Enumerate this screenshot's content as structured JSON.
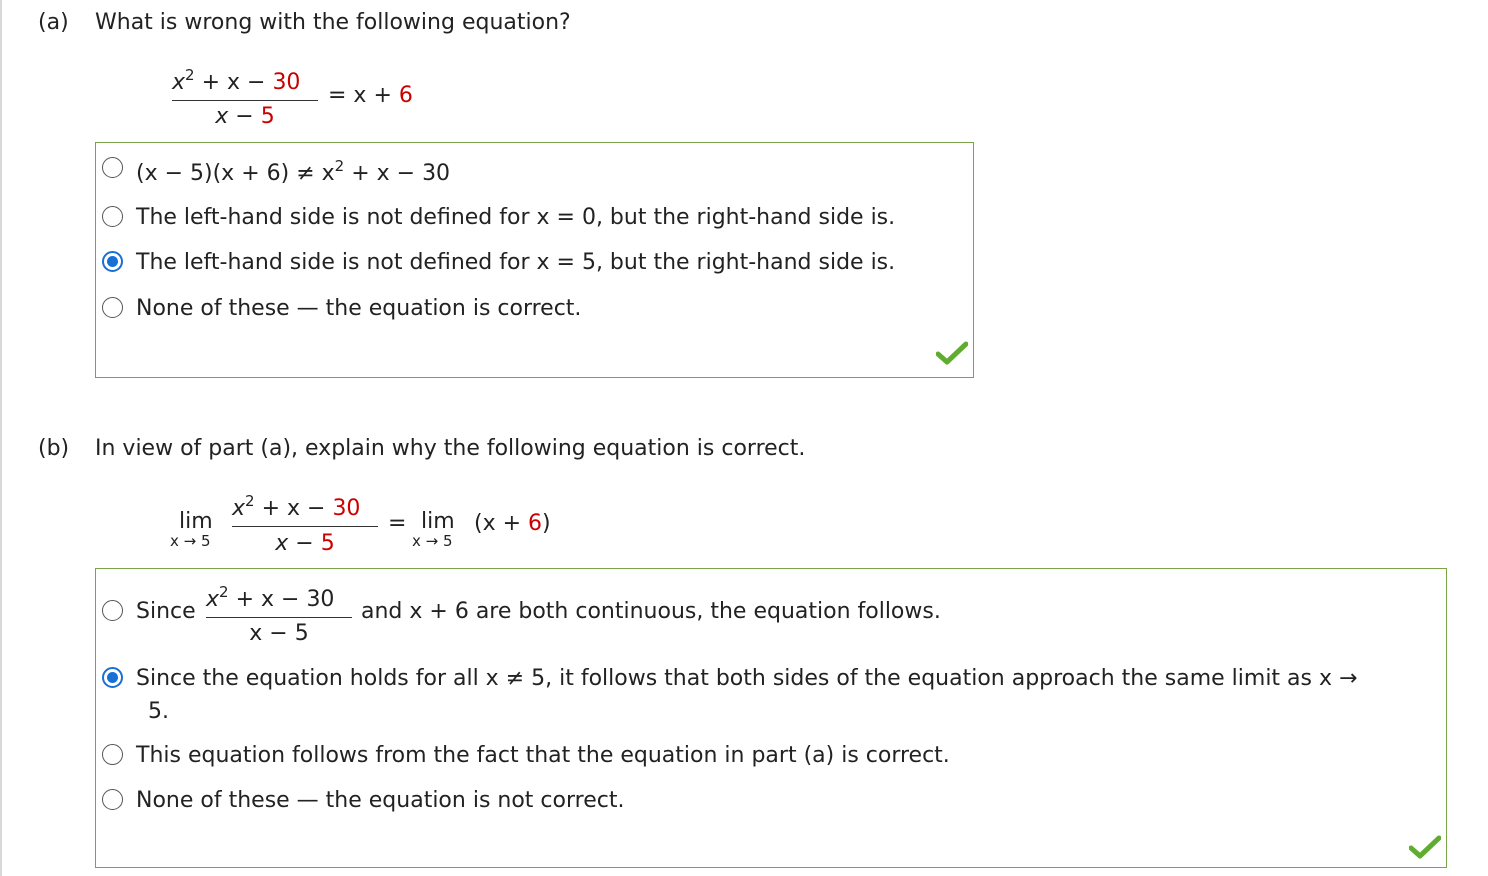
{
  "part_a": {
    "label": "(a)",
    "question": "What is wrong with the following equation?",
    "equation": {
      "num_x": "x",
      "num_exp": "2",
      "num_rest": " + x − ",
      "num_const": "30",
      "den_var": "x − ",
      "den_const": "5",
      "rhs_eq": "= x + ",
      "rhs_const": "6"
    },
    "options": [
      {
        "pre": "(x − 5)(x + 6) ≠ x",
        "exp": "2",
        "post": " + x − 30",
        "selected": false
      },
      {
        "text": "The left-hand side is not defined for x = 0, but the right-hand side is.",
        "selected": false
      },
      {
        "text": "The left-hand side is not defined for x = 5, but the right-hand side is.",
        "selected": true
      },
      {
        "text": "None of these — the equation is correct.",
        "selected": false
      }
    ]
  },
  "part_b": {
    "label": "(b)",
    "question": "In view of part (a), explain why the following equation is correct.",
    "equation": {
      "lim": "lim",
      "lim_sub": "x → 5",
      "num_x": "x",
      "num_exp": "2",
      "num_rest": " + x − ",
      "num_const": "30",
      "den_var": "x − ",
      "den_const": "5",
      "eq": "=",
      "rhs_lim": "lim",
      "rhs_sub": "x → 5",
      "rhs_open": "(x + ",
      "rhs_const": "6",
      "rhs_close": ")"
    },
    "options": [
      {
        "pre": "Since",
        "frac_num_x": "x",
        "frac_num_exp": "2",
        "frac_num_rest": " + x − 30",
        "frac_den": "x − 5",
        "post": "and x + 6 are both continuous, the equation follows.",
        "selected": false
      },
      {
        "line1": "Since the equation holds for all x ≠ 5, it follows that both sides of the equation approach the same limit as x →",
        "line2": "5.",
        "selected": true
      },
      {
        "text": "This equation follows from the fact that the equation in part (a) is correct.",
        "selected": false
      },
      {
        "text": "None of these — the equation is not correct.",
        "selected": false
      }
    ]
  },
  "colors": {
    "accent": "#1a6fd6",
    "highlight": "#cc0000",
    "box_border": "#7aa34a",
    "check": "#5fad2e"
  },
  "icons": {
    "correct": "check-icon"
  }
}
